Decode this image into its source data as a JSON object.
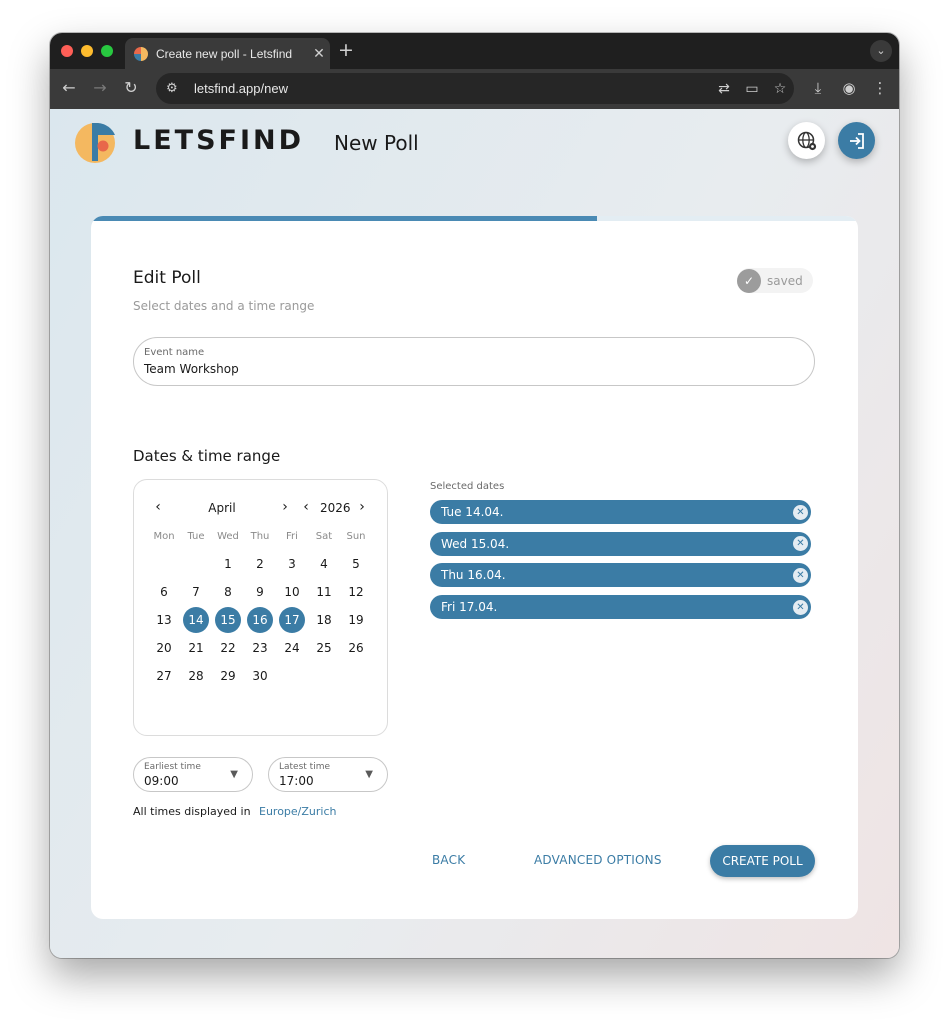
{
  "browser": {
    "tab_title": "Create new poll - Letsfind",
    "url": "letsfind.app/new"
  },
  "header": {
    "logo_text": "LETSFIND",
    "page_title": "New Poll"
  },
  "progress": {
    "fraction": 0.66
  },
  "form": {
    "title": "Edit Poll",
    "subtitle": "Select dates and a time range",
    "saved_label": "saved",
    "event_name": {
      "label": "Event name",
      "value": "Team Workshop"
    },
    "section_title": "Dates & time range"
  },
  "calendar": {
    "month": "April",
    "year": "2026",
    "weekdays": [
      "Mon",
      "Tue",
      "Wed",
      "Thu",
      "Fri",
      "Sat",
      "Sun"
    ],
    "weeks": [
      [
        "",
        "",
        "1",
        "2",
        "3",
        "4",
        "5"
      ],
      [
        "6",
        "7",
        "8",
        "9",
        "10",
        "11",
        "12"
      ],
      [
        "13",
        "14",
        "15",
        "16",
        "17",
        "18",
        "19"
      ],
      [
        "20",
        "21",
        "22",
        "23",
        "24",
        "25",
        "26"
      ],
      [
        "27",
        "28",
        "29",
        "30",
        "",
        "",
        ""
      ]
    ],
    "selected": [
      "14",
      "15",
      "16",
      "17"
    ]
  },
  "selected_dates": {
    "label": "Selected dates",
    "items": [
      "Tue 14.04.",
      "Wed 15.04.",
      "Thu 16.04.",
      "Fri 17.04."
    ]
  },
  "time": {
    "earliest": {
      "label": "Earliest time",
      "value": "09:00"
    },
    "latest": {
      "label": "Latest time",
      "value": "17:00"
    },
    "timezone_label": "All times displayed in",
    "timezone": "Europe/Zurich"
  },
  "actions": {
    "back": "BACK",
    "advanced": "ADVANCED OPTIONS",
    "create": "CREATE POLL"
  },
  "colors": {
    "accent": "#3b7ca5",
    "progress": "#4a8ab4",
    "logo_orange": "#f4b860",
    "logo_red": "#e8684a"
  }
}
